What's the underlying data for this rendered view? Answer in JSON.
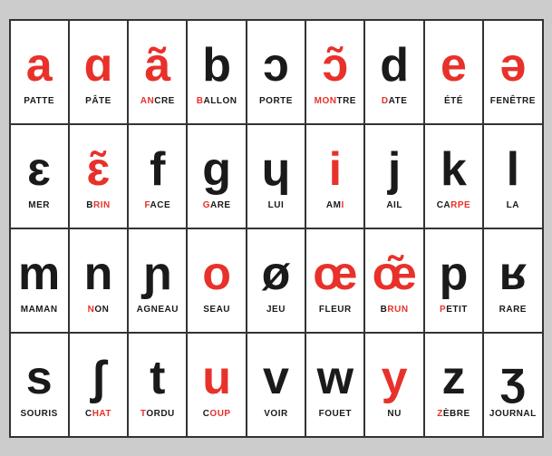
{
  "table": {
    "rows": [
      {
        "cells": [
          {
            "symbol": "a",
            "symbolColor": "red",
            "label": "PATTE",
            "highlight": ""
          },
          {
            "symbol": "ɑ",
            "symbolColor": "red",
            "label": "PÂTE",
            "highlight": ""
          },
          {
            "symbol": "ã",
            "symbolColor": "red",
            "label": "ANCRE",
            "highlightChars": "AN"
          },
          {
            "symbol": "b",
            "symbolColor": "black",
            "label": "BALLON",
            "highlightChars": "B"
          },
          {
            "symbol": "ɔ",
            "symbolColor": "black",
            "label": "PORTE",
            "highlightChars": ""
          },
          {
            "symbol": "ɔ̃",
            "symbolColor": "red",
            "label": "MONTRE",
            "highlightChars": "MON"
          },
          {
            "symbol": "d",
            "symbolColor": "black",
            "label": "DATE",
            "highlightChars": "D"
          },
          {
            "symbol": "e",
            "symbolColor": "red",
            "label": "ÉTÉ",
            "highlight": ""
          },
          {
            "symbol": "ə",
            "symbolColor": "red",
            "label": "FENÊTRE",
            "highlight": ""
          }
        ]
      },
      {
        "cells": [
          {
            "symbol": "ɛ",
            "symbolColor": "black",
            "label": "MER",
            "highlightChars": ""
          },
          {
            "symbol": "ɛ̃",
            "symbolColor": "red",
            "label": "BRIN",
            "highlightChars": "BRIN"
          },
          {
            "symbol": "f",
            "symbolColor": "black",
            "label": "FACE",
            "highlightChars": "F"
          },
          {
            "symbol": "g",
            "symbolColor": "black",
            "label": "GARE",
            "highlightChars": "G"
          },
          {
            "symbol": "ɥ",
            "symbolColor": "black",
            "label": "LUI",
            "highlightChars": ""
          },
          {
            "symbol": "i",
            "symbolColor": "red",
            "label": "AMI",
            "highlightChars": "AMI"
          },
          {
            "symbol": "j",
            "symbolColor": "black",
            "label": "AIL",
            "highlightChars": ""
          },
          {
            "symbol": "k",
            "symbolColor": "black",
            "label": "CARPE",
            "highlightChars": "CARPE"
          },
          {
            "symbol": "l",
            "symbolColor": "black",
            "label": "LA",
            "highlightChars": ""
          }
        ]
      },
      {
        "cells": [
          {
            "symbol": "m",
            "symbolColor": "black",
            "label": "MAMAN",
            "highlightChars": ""
          },
          {
            "symbol": "n",
            "symbolColor": "black",
            "label": "NON",
            "highlightChars": "N"
          },
          {
            "symbol": "ɲ",
            "symbolColor": "black",
            "label": "AGNEAU",
            "highlightChars": ""
          },
          {
            "symbol": "o",
            "symbolColor": "red",
            "label": "SEAU",
            "highlightChars": ""
          },
          {
            "symbol": "ø",
            "symbolColor": "black",
            "label": "JEU",
            "highlightChars": ""
          },
          {
            "symbol": "œ",
            "symbolColor": "red",
            "label": "FLEUR",
            "highlightChars": ""
          },
          {
            "symbol": "œ̃",
            "symbolColor": "red",
            "label": "BRUN",
            "highlightChars": "BRUN"
          },
          {
            "symbol": "p",
            "symbolColor": "black",
            "label": "PETIT",
            "highlightChars": "P"
          },
          {
            "symbol": "ʁ",
            "symbolColor": "black",
            "label": "RARE",
            "highlightChars": ""
          }
        ]
      },
      {
        "cells": [
          {
            "symbol": "s",
            "symbolColor": "black",
            "label": "SOURIS",
            "highlightChars": ""
          },
          {
            "symbol": "ʃ",
            "symbolColor": "black",
            "label": "CHAT",
            "highlightChars": "CHAT"
          },
          {
            "symbol": "t",
            "symbolColor": "black",
            "label": "TORDU",
            "highlightChars": "T"
          },
          {
            "symbol": "u",
            "symbolColor": "red",
            "label": "COUP",
            "highlightChars": "COUP"
          },
          {
            "symbol": "v",
            "symbolColor": "black",
            "label": "VOIR",
            "highlightChars": ""
          },
          {
            "symbol": "w",
            "symbolColor": "black",
            "label": "FOUET",
            "highlightChars": ""
          },
          {
            "symbol": "y",
            "symbolColor": "red",
            "label": "NU",
            "highlightChars": ""
          },
          {
            "symbol": "z",
            "symbolColor": "black",
            "label": "ZÈBRE",
            "highlightChars": "Z"
          },
          {
            "symbol": "ʒ",
            "symbolColor": "black",
            "label": "JOURNAL",
            "highlightChars": ""
          }
        ]
      }
    ]
  }
}
